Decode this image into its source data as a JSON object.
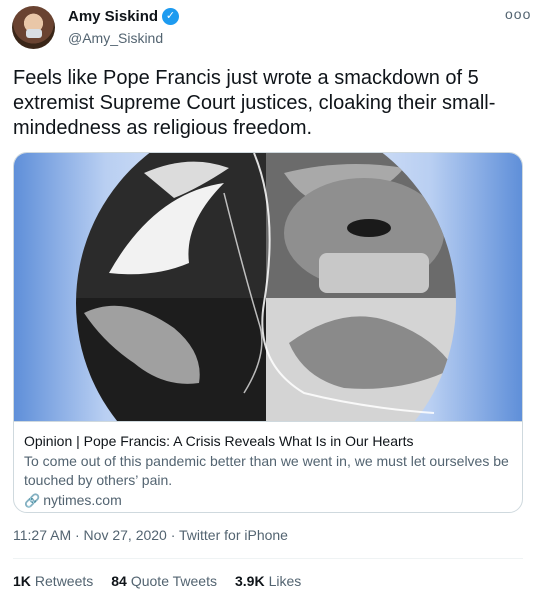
{
  "author": {
    "name": "Amy Siskind",
    "handle": "@Amy_Siskind",
    "verified_glyph": "✓"
  },
  "more_glyph": "ooo",
  "tweet_text": "Feels like Pope Francis just wrote a smackdown of 5 extremist Supreme Court justices, cloaking their small-mindedness as religious freedom.",
  "card": {
    "title": "Opinion | Pope Francis: A Crisis Reveals What Is in Our Hearts",
    "description": "To come out of this pandemic better than we went in, we must let ourselves be touched by others’ pain.",
    "link_glyph": "🔗",
    "domain": "nytimes.com"
  },
  "timestamp": "11:27 AM · Nov 27, 2020 · Twitter for iPhone",
  "stats": {
    "retweets": {
      "count": "1K",
      "label": "Retweets"
    },
    "quotes": {
      "count": "84",
      "label": "Quote Tweets"
    },
    "likes": {
      "count": "3.9K",
      "label": "Likes"
    }
  },
  "colors": {
    "verified": "#1d9bf0",
    "secondary_text": "#536471",
    "card_bg_blue": "#5f8fd9"
  }
}
